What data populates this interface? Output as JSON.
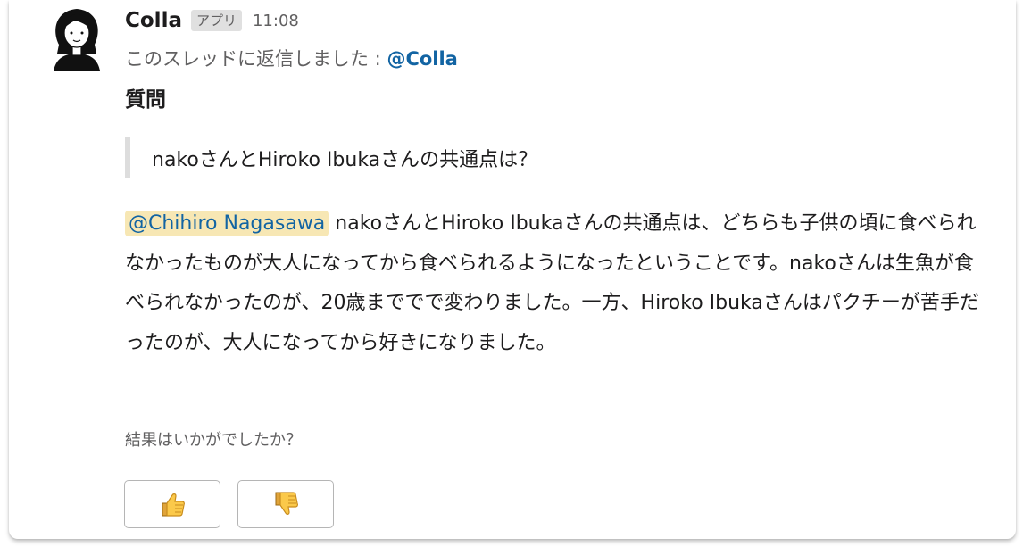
{
  "message": {
    "sender": "Colla",
    "app_badge": "アプリ",
    "timestamp": "11:08",
    "thread_reply_prefix": "このスレッドに返信しました : ",
    "thread_reply_mention": "@Colla",
    "section_title": "質問",
    "quote": "nakoさんとHiroko Ibukaさんの共通点は？",
    "answer_mention": "@Chihiro Nagasawa",
    "answer_text": " nakoさんとHiroko Ibukaさんの共通点は、どちらも子供の頃に食べられなかったものが大人になってから食べられるようになったということです。nakoさんは生魚が食べられなかったのが、20歳まででで変わりました。一方、Hiroko Ibukaさんはパクチーが苦手だったのが、大人になってから好きになりました。",
    "feedback_question": "結果はいかがでしたか？"
  },
  "icons": {
    "avatar": "woman-avatar-icon",
    "thumbs_up": "thumbs-up-icon",
    "thumbs_down": "thumbs-down-icon"
  },
  "colors": {
    "link": "#1264a3",
    "mention_highlight": "#f7e7b4",
    "muted_text": "#616061",
    "quote_bar": "#dddddd"
  }
}
